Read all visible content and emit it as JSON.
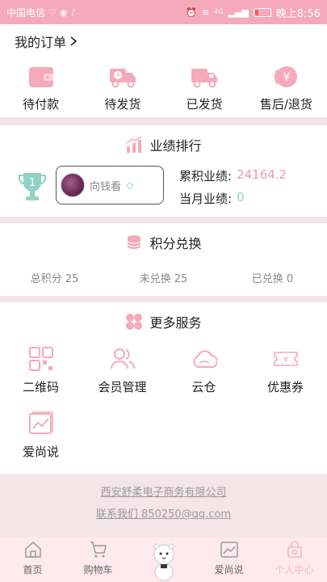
{
  "status_bar": {
    "carrier": "中国电信",
    "network": "4G",
    "time": "晚上8:56",
    "battery_level": 0.2
  },
  "orders": {
    "title": "我的订单",
    "items": [
      {
        "label": "待付款",
        "icon": "wallet-icon"
      },
      {
        "label": "待发货",
        "icon": "truck-clock-icon"
      },
      {
        "label": "已发货",
        "icon": "truck-icon"
      },
      {
        "label": "售后/退货",
        "icon": "yen-return-icon"
      }
    ]
  },
  "ranking": {
    "title": "业绩排行",
    "rank_number": "1",
    "user_name": "向钱看",
    "cumulative_label": "累积业绩:",
    "cumulative_value": "24164.2",
    "monthly_label": "当月业绩:",
    "monthly_value": "0"
  },
  "points": {
    "title": "积分兑换",
    "total": "总积分 25",
    "unredeemed": "未兑换 25",
    "redeemed": "已兑换 0"
  },
  "services": {
    "title": "更多服务",
    "items": [
      {
        "label": "二维码",
        "icon": "qr-code-icon"
      },
      {
        "label": "会员管理",
        "icon": "members-icon"
      },
      {
        "label": "云仓",
        "icon": "cloud-icon"
      },
      {
        "label": "优惠券",
        "icon": "coupon-icon"
      },
      {
        "label": "爱尚说",
        "icon": "chart-icon"
      }
    ]
  },
  "footer": {
    "company": "西安舒柔电子商务有限公司",
    "contact": "联系我们 850250@qq.com"
  },
  "tabbar": {
    "items": [
      {
        "label": "首页",
        "icon": "home-icon",
        "active": false
      },
      {
        "label": "购物车",
        "icon": "cart-icon",
        "active": false
      },
      {
        "label": "",
        "icon": "mascot-icon",
        "active": false
      },
      {
        "label": "爱尚说",
        "icon": "chart-icon",
        "active": false
      },
      {
        "label": "个人中心",
        "icon": "user-center-icon",
        "active": true
      }
    ]
  },
  "colors": {
    "accent": "#f5a9ba",
    "value_pink": "#f09aae",
    "value_teal": "#8fd3c5",
    "tabbar_bg": "#fde9ee"
  }
}
